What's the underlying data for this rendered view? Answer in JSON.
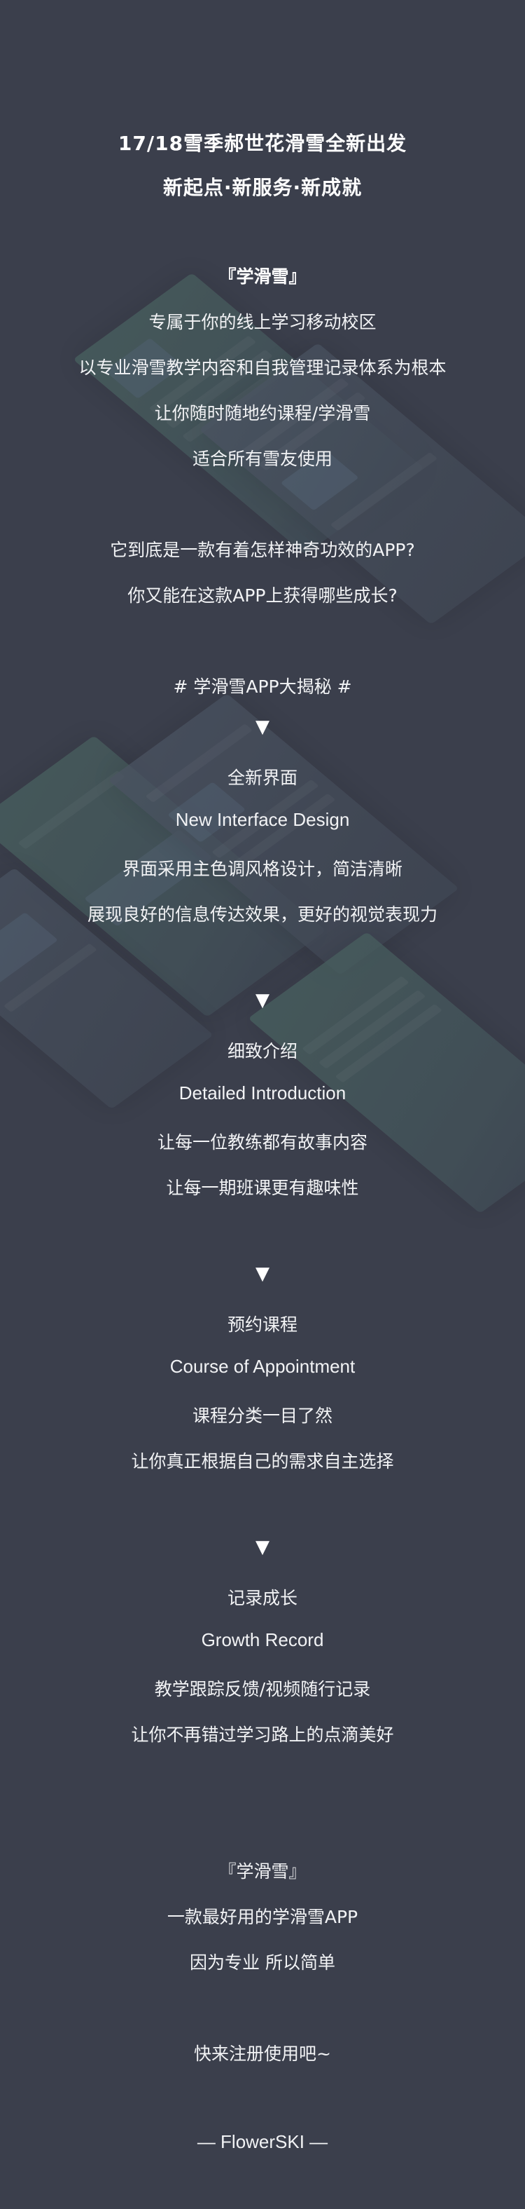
{
  "header": {
    "line1": "17/18雪季郝世花滑雪全新出发",
    "line2": "新起点·新服务·新成就"
  },
  "intro": {
    "brand": "『学滑雪』",
    "lines": [
      "专属于你的线上学习移动校区",
      "以专业滑雪教学内容和自我管理记录体系为根本",
      "让你随时随地约课程/学滑雪",
      "适合所有雪友使用"
    ]
  },
  "question": {
    "lines": [
      "它到底是一款有着怎样神奇功效的APP?",
      "你又能在这款APP上获得哪些成长?"
    ]
  },
  "reveal": {
    "tag": "# 学滑雪APP大揭秘 #",
    "arrow": "▼"
  },
  "sections": [
    {
      "title_cn": "全新界面",
      "title_en": "New Interface Design",
      "lines": [
        "界面采用主色调风格设计，简洁清晰",
        "展现良好的信息传达效果，更好的视觉表现力"
      ]
    },
    {
      "title_cn": "细致介绍",
      "title_en": "Detailed Introduction",
      "lines": [
        "让每一位教练都有故事内容",
        "让每一期班课更有趣味性"
      ]
    },
    {
      "title_cn": "预约课程",
      "title_en": "Course of Appointment",
      "lines": [
        "课程分类一目了然",
        "让你真正根据自己的需求自主选择"
      ]
    },
    {
      "title_cn": "记录成长",
      "title_en": "Growth Record",
      "lines": [
        "教学跟踪反馈/视频随行记录",
        "让你不再错过学习路上的点滴美好"
      ]
    }
  ],
  "outro": {
    "brand": "『学滑雪』",
    "line1": "一款最好用的学滑雪APP",
    "line2": "因为专业 所以简单",
    "cta": "快来注册使用吧~",
    "signature": "— FlowerSKI —"
  },
  "colors": {
    "background": "#3b3f4c",
    "text": "#ffffff"
  }
}
